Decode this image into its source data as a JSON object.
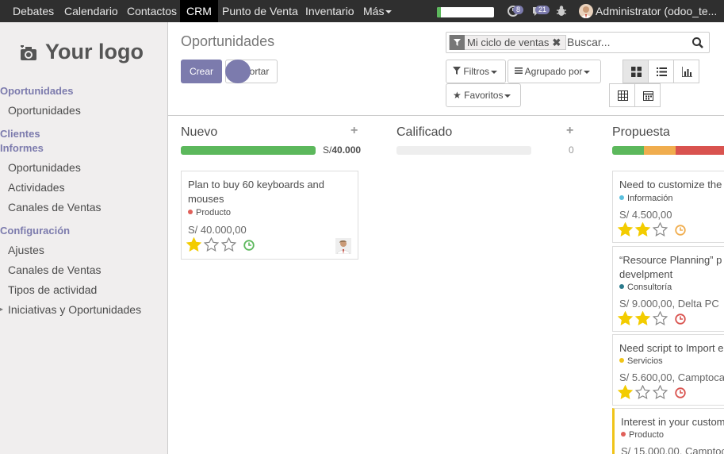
{
  "topbar": {
    "menus": [
      {
        "label": "Debates",
        "active": false
      },
      {
        "label": "Calendario",
        "active": false
      },
      {
        "label": "Contactos",
        "active": false
      },
      {
        "label": "CRM",
        "active": true
      },
      {
        "label": "Punto de Venta",
        "active": false
      },
      {
        "label": "Inventario",
        "active": false
      },
      {
        "label": "Más",
        "active": false
      }
    ],
    "activity_progress": 0.07,
    "messages_count": "8",
    "chat_count": "21",
    "user_name": "Administrator (odoo_te..."
  },
  "sidebar": {
    "logo_text": "Your logo",
    "sections": [
      {
        "heading": "Oportunidades",
        "items": [
          "Oportunidades"
        ]
      },
      {
        "heading": "Clientes",
        "items": []
      },
      {
        "heading": "Informes",
        "items": [
          "Oportunidades",
          "Actividades",
          "Canales de Ventas"
        ]
      },
      {
        "heading": "Configuración",
        "items": [
          "Ajustes",
          "Canales de Ventas",
          "Tipos de actividad",
          "Iniciativas y Oportunidades"
        ]
      }
    ]
  },
  "control_panel": {
    "breadcrumb": "Oportunidades",
    "create_label": "Crear",
    "import_label": "Importar",
    "search": {
      "facet_label": "Mi ciclo de ventas",
      "placeholder": "Buscar..."
    },
    "filters_label": "Filtros",
    "groupby_label": "Agrupado por",
    "favorites_label": "Favoritos"
  },
  "kanban": {
    "columns": [
      {
        "title": "Nuevo",
        "amount_prefix": "S/",
        "amount": "40.000",
        "progress": [
          {
            "color": "#5cb85c",
            "fraction": 1.0
          }
        ],
        "cards": [
          {
            "title": "Plan to buy 60 keyboards and mouses",
            "tag": "Producto",
            "tag_color": "#e0605a",
            "amount": "S/ 40.000,00",
            "stars": 1,
            "clock_color": "#5cb85c"
          }
        ]
      },
      {
        "title": "Calificado",
        "amount": "0",
        "progress": [],
        "cards": []
      },
      {
        "title": "Propuesta",
        "progress": [
          {
            "color": "#5cb85c",
            "fraction": 0.25
          },
          {
            "color": "#f0ad4e",
            "fraction": 0.25
          },
          {
            "color": "#d9534f",
            "fraction": 0.5
          }
        ],
        "cards": [
          {
            "title": "Need to customize the",
            "tag": "Información",
            "tag_color": "#5bc0de",
            "amount": "S/ 4.500,00",
            "stars": 2,
            "clock_color": "#f0ad4e"
          },
          {
            "title": "“Resource Planning” p develpment",
            "tag": "Consultoría",
            "tag_color": "#2b7a8c",
            "amount": "S/ 9.000,00, Delta PC",
            "stars": 2,
            "clock_color": "#d9534f"
          },
          {
            "title": "Need script to Import e",
            "tag": "Servicios",
            "tag_color": "#f0c419",
            "amount": "S/ 5.600,00, Camptoca",
            "stars": 1,
            "clock_color": "#d9534f"
          },
          {
            "title": "Interest in your custom",
            "tag": "Producto",
            "tag_color": "#e0605a",
            "amount": "S/ 15.000,00, Camptoc",
            "stars": 0,
            "clock_color": ""
          }
        ]
      }
    ]
  }
}
